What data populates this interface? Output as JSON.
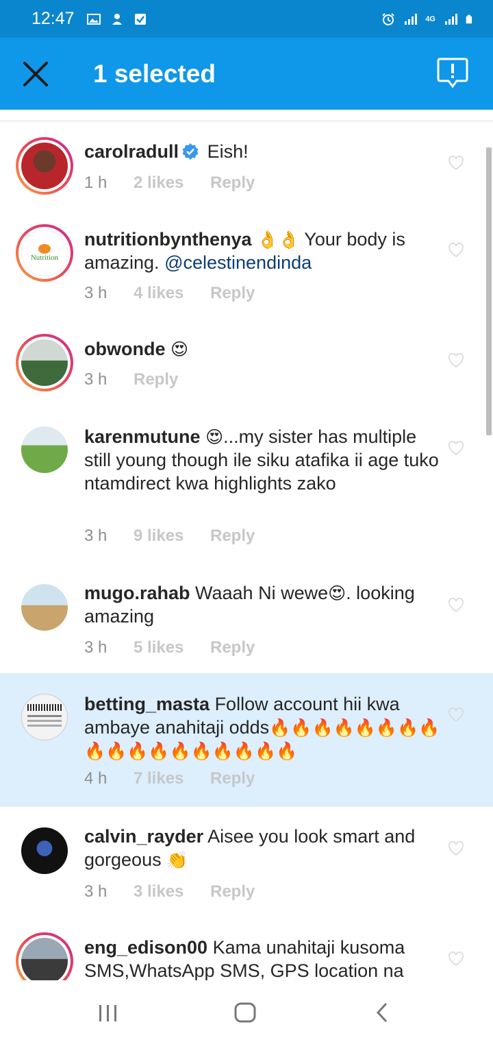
{
  "status_bar": {
    "time": "12:47",
    "network": "4G"
  },
  "header": {
    "title": "1 selected"
  },
  "comments": [
    {
      "username": "carolradull",
      "text": "Eish!",
      "time": "1 h",
      "likes": "2 likes",
      "reply": "Reply"
    },
    {
      "username": "nutritionbynthenya",
      "emoji": "👌👌",
      "text": "Your body is amazing.",
      "mention": "@celestinendinda",
      "time": "3 h",
      "likes": "4 likes",
      "reply": "Reply",
      "avatar_text": "Nutrition"
    },
    {
      "username": "obwonde",
      "emoji": "😍",
      "time": "3 h",
      "reply": "Reply"
    },
    {
      "username": "karenmutune",
      "emoji": "😍",
      "text": "...my sister has multiple still young though ile siku atafika ii age tuko ntamdirect kwa highlights zako",
      "time": "3 h",
      "likes": "9 likes",
      "reply": "Reply"
    },
    {
      "username": "mugo.rahab",
      "text": "Waaah Ni wewe",
      "emoji": "😍",
      "text2": ". looking amazing",
      "time": "3 h",
      "likes": "5 likes",
      "reply": "Reply"
    },
    {
      "username": "betting_masta",
      "text": "Follow account hii kwa ambaye anahitaji odds",
      "emoji": "🔥🔥🔥🔥🔥🔥🔥🔥🔥🔥🔥🔥🔥🔥🔥🔥🔥🔥",
      "time": "4 h",
      "likes": "7 likes",
      "reply": "Reply"
    },
    {
      "username": "calvin_rayder",
      "text": "Aisee you look smart and gorgeous",
      "emoji": "👏",
      "time": "3 h",
      "likes": "3 likes",
      "reply": "Reply"
    },
    {
      "username": "eng_edison00",
      "text": "Kama unahitaji kusoma SMS,WhatsApp SMS, GPS location na"
    }
  ],
  "colors": {
    "status_bar": "#0a86cf",
    "top_bar": "#0f97ea",
    "selected_row": "#ddeefd",
    "mention": "#0b3d75"
  }
}
